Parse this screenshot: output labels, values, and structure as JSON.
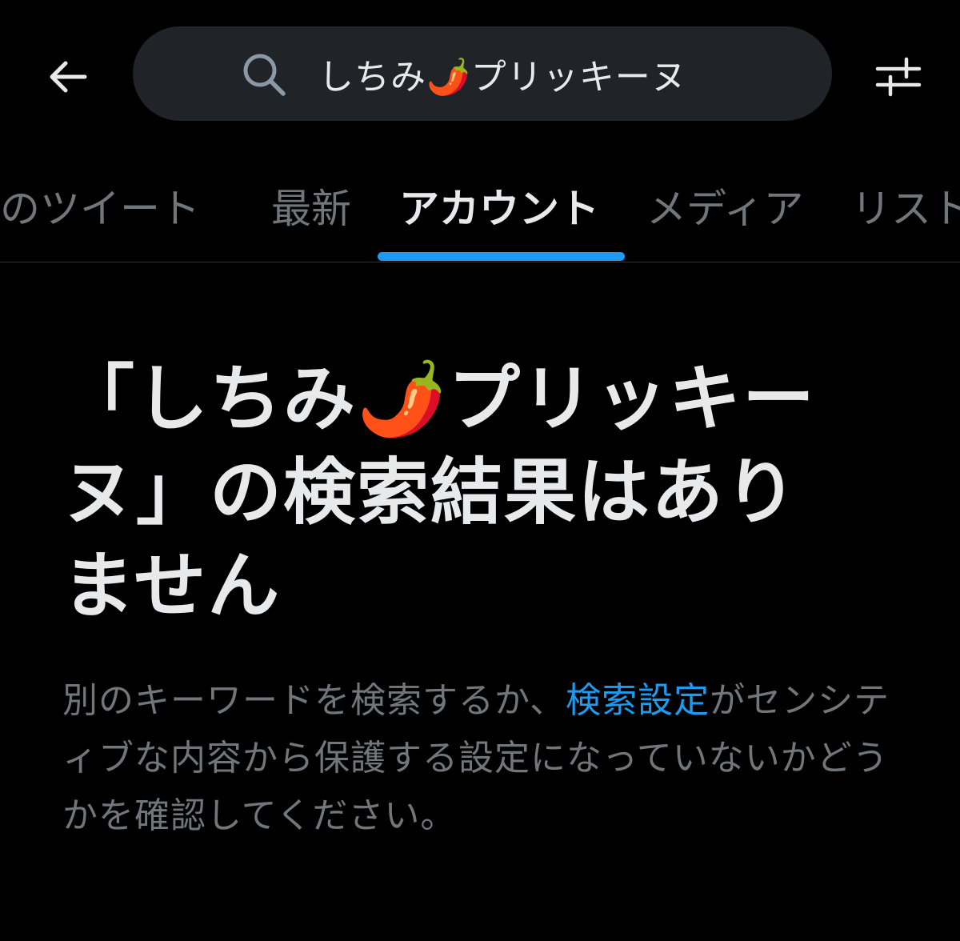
{
  "header": {
    "search_query": "しちみ🌶️プリッキーヌ"
  },
  "tabs": [
    {
      "label": "話題のツイート"
    },
    {
      "label": "最新"
    },
    {
      "label": "アカウント"
    },
    {
      "label": "メディア"
    },
    {
      "label": "リスト"
    }
  ],
  "active_tab": "アカウント",
  "empty_state": {
    "title_line1": "「しちみ🌶️プリッキー",
    "title_line2": "ヌ」の検索結果はあり",
    "title_line3": "ません",
    "body_before_link": "別のキーワードを検索するか、",
    "body_link": "検索設定",
    "body_after_link": "がセンシティブな内容から保護する設定になっていないかどうかを確認してください。"
  },
  "colors": {
    "background": "#000000",
    "search_field": "#202327",
    "primary_text": "#e7e9ea",
    "secondary_text": "#71767b",
    "accent": "#1d9bf0",
    "divider": "#2f3336"
  },
  "icons": {
    "back": "arrow-left-icon",
    "search": "search-icon",
    "filter": "sliders-icon"
  }
}
